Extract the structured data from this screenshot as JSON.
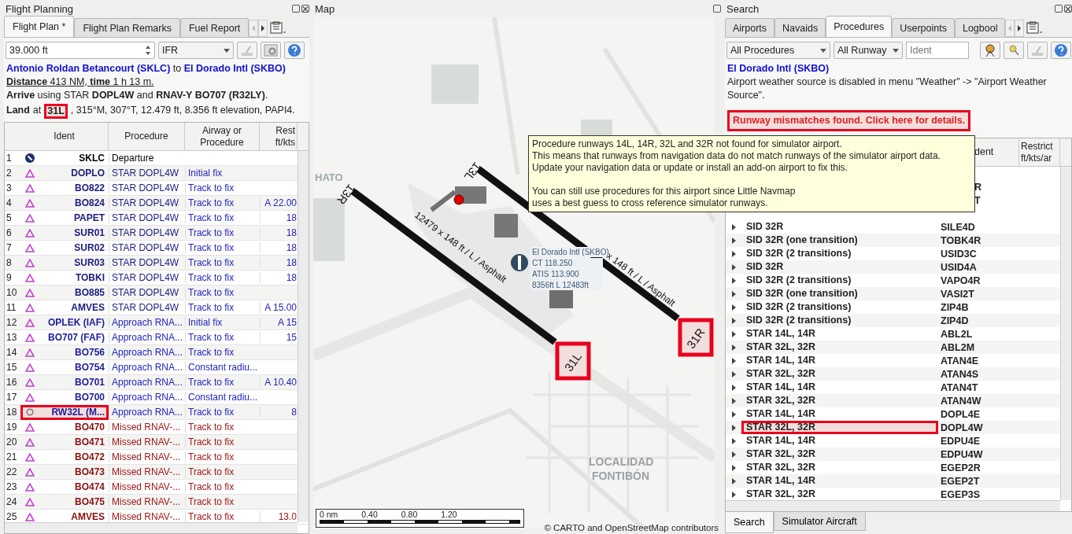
{
  "flight_planning": {
    "title": "Flight Planning",
    "tabs": [
      {
        "label": "Flight Plan *",
        "selected": true
      },
      {
        "label": "Flight Plan Remarks",
        "selected": false
      },
      {
        "label": "Fuel Report",
        "selected": false
      }
    ],
    "altitude": "39.000 ft",
    "flight_rules": "IFR",
    "route": {
      "from": "Antonio Roldan Betancourt (SKLC)",
      "joiner": "to",
      "to": "El Dorado Intl (SKBO)"
    },
    "distance": "**Distance** 413 NM, **time** 1 h 13 m.",
    "arrive": "**Arrive** using STAR **DOPL4W** and **RNAV-Y BO707 (R32LY)**.",
    "land": {
      "label": "Land",
      "prefix": "at",
      "runway": "31L",
      "runway_highlighted": true,
      "rest": ", 315°M, 307°T, 12.479 ft, 8.356 ft elevation, PAPI4."
    },
    "table": {
      "columns": [
        "Ident",
        "Procedure",
        "Airway or Procedure",
        "Rest ft/kts"
      ],
      "rows": [
        {
          "n": "1",
          "kind": "departure",
          "ident": "SKLC",
          "procedure": "Departure",
          "highlighted": false
        },
        {
          "n": "2",
          "kind": "star",
          "ident": "DOPLO",
          "procedure": "STAR DOPL4W",
          "leg": "Initial fix",
          "highlighted": false
        },
        {
          "n": "3",
          "kind": "star",
          "ident": "BO822",
          "procedure": "STAR DOPL4W",
          "leg": "Track to fix",
          "highlighted": false
        },
        {
          "n": "4",
          "kind": "star",
          "ident": "BO824",
          "procedure": "STAR DOPL4W",
          "leg": "Track to fix",
          "restriction": "A 22.00",
          "highlighted": false
        },
        {
          "n": "5",
          "kind": "star",
          "ident": "PAPET",
          "procedure": "STAR DOPL4W",
          "leg": "Track to fix",
          "restriction": "18",
          "highlighted": false
        },
        {
          "n": "6",
          "kind": "star",
          "ident": "SUR01",
          "procedure": "STAR DOPL4W",
          "leg": "Track to fix",
          "restriction": "18",
          "highlighted": false
        },
        {
          "n": "7",
          "kind": "star",
          "ident": "SUR02",
          "procedure": "STAR DOPL4W",
          "leg": "Track to fix",
          "restriction": "18",
          "highlighted": false
        },
        {
          "n": "8",
          "kind": "star",
          "ident": "SUR03",
          "procedure": "STAR DOPL4W",
          "leg": "Track to fix",
          "restriction": "18",
          "highlighted": false
        },
        {
          "n": "9",
          "kind": "star",
          "ident": "TOBKI",
          "procedure": "STAR DOPL4W",
          "leg": "Track to fix",
          "restriction": "18",
          "highlighted": false
        },
        {
          "n": "10",
          "kind": "star",
          "ident": "BO885",
          "procedure": "STAR DOPL4W",
          "leg": "Track to fix",
          "highlighted": false
        },
        {
          "n": "11",
          "kind": "star",
          "ident": "AMVES",
          "procedure": "STAR DOPL4W",
          "leg": "Track to fix",
          "restriction": "A 15.00",
          "highlighted": false
        },
        {
          "n": "12",
          "kind": "approach",
          "ident": "OPLEK (IAF)",
          "procedure": "Approach RNA...",
          "leg": "Initial fix",
          "restriction": "A 15",
          "highlighted": false
        },
        {
          "n": "13",
          "kind": "approach",
          "ident": "BO707 (FAF)",
          "procedure": "Approach RNA...",
          "leg": "Track to fix",
          "restriction": "15",
          "highlighted": false
        },
        {
          "n": "14",
          "kind": "approach",
          "ident": "BO756",
          "procedure": "Approach RNA...",
          "leg": "Track to fix",
          "highlighted": false
        },
        {
          "n": "15",
          "kind": "approach",
          "ident": "BO754",
          "procedure": "Approach RNA...",
          "leg": "Constant radiu...",
          "highlighted": false
        },
        {
          "n": "16",
          "kind": "approach",
          "ident": "BO701",
          "procedure": "Approach RNA...",
          "leg": "Track to fix",
          "restriction": "A 10.40",
          "highlighted": false
        },
        {
          "n": "17",
          "kind": "approach",
          "ident": "BO700",
          "procedure": "Approach RNA...",
          "leg": "Constant radiu...",
          "highlighted": false
        },
        {
          "n": "18",
          "kind": "runway",
          "ident": "RW32L (M...",
          "procedure": "Approach RNA...",
          "leg": "Track to fix",
          "restriction": "8",
          "highlighted": true
        },
        {
          "n": "19",
          "kind": "missed",
          "ident": "BO470",
          "procedure": "Missed RNAV-...",
          "leg": "Track to fix",
          "highlighted": false
        },
        {
          "n": "20",
          "kind": "missed",
          "ident": "BO471",
          "procedure": "Missed RNAV-...",
          "leg": "Track to fix",
          "highlighted": false
        },
        {
          "n": "21",
          "kind": "missed",
          "ident": "BO472",
          "procedure": "Missed RNAV-...",
          "leg": "Track to fix",
          "highlighted": false
        },
        {
          "n": "22",
          "kind": "missed",
          "ident": "BO473",
          "procedure": "Missed RNAV-...",
          "leg": "Track to fix",
          "highlighted": false
        },
        {
          "n": "23",
          "kind": "missed",
          "ident": "BO474",
          "procedure": "Missed RNAV-...",
          "leg": "Track to fix",
          "highlighted": false
        },
        {
          "n": "24",
          "kind": "missed",
          "ident": "BO475",
          "procedure": "Missed RNAV-...",
          "leg": "Track to fix",
          "highlighted": false
        },
        {
          "n": "25",
          "kind": "missed",
          "ident": "AMVES",
          "procedure": "Missed RNAV-...",
          "leg": "Track to fix",
          "restriction": "13.0",
          "highlighted": false
        }
      ]
    }
  },
  "map": {
    "title": "Map",
    "place_labels": [
      "HATO",
      "LOCALIDAD",
      "FONTIBÓN"
    ],
    "runways": [
      {
        "end_a": "13R",
        "end_b": "31L",
        "label": "12479 x 148 ft / L / Asphalt",
        "end_b_highlighted": true
      },
      {
        "end_a": "13L",
        "end_b": "31R",
        "label": "x 148 ft / L / Asphalt",
        "end_b_highlighted": true
      }
    ],
    "airport_label": [
      "El Dorado Intl (SKBO)",
      "CT 118.250",
      "ATIS 113.900",
      "8356ft L 12483ft"
    ],
    "scale": [
      "0 nm",
      "0.40",
      "0.80",
      "1.20"
    ],
    "attribution": "© CARTO and OpenStreetMap contributors"
  },
  "tooltip": {
    "paragraphs": [
      [
        "Procedure runways 14L, 14R, 32L and 32R not found for simulator airport.",
        "This means that runways from navigation data do not match runways of the simulator airport data.",
        "Update your navigation data or update or install an add-on airport to fix this."
      ],
      [
        "You can still use procedures for this airport since Little Navmap",
        "uses a best guess to cross reference simulator runways."
      ]
    ]
  },
  "search": {
    "title": "Search",
    "tabs": [
      {
        "label": "Airports",
        "selected": false
      },
      {
        "label": "Navaids",
        "selected": false
      },
      {
        "label": "Procedures",
        "selected": true
      },
      {
        "label": "Userpoints",
        "selected": false
      },
      {
        "label": "Logbool",
        "selected": false
      }
    ],
    "filter_type": "All Procedures",
    "filter_runway": "All Runway",
    "ident_placeholder": "Ident",
    "airport": "El Dorado Intl (SKBO)",
    "weather_note": "Airport weather source is disabled in menu \"Weather\" -> \"Airport Weather Source\".",
    "mismatch_link": "Runway mismatches found. Click here for details.",
    "mismatch_highlighted": true,
    "columns": [
      "dent",
      "Restrict ft/kts/ar"
    ],
    "partial_rows": [
      "R",
      "T"
    ],
    "rows": [
      {
        "description": "SID 32R",
        "ident": "SILE4D",
        "highlighted": false
      },
      {
        "description": "SID 32R (one transition)",
        "ident": "TOBK4R",
        "highlighted": false
      },
      {
        "description": "SID 32R (2 transitions)",
        "ident": "USID3C",
        "highlighted": false
      },
      {
        "description": "SID 32R",
        "ident": "USID4A",
        "highlighted": false
      },
      {
        "description": "SID 32R (2 transitions)",
        "ident": "VAPO4R",
        "highlighted": false
      },
      {
        "description": "SID 32R (one transition)",
        "ident": "VASI2T",
        "highlighted": false
      },
      {
        "description": "SID 32R (2 transitions)",
        "ident": "ZIP4B",
        "highlighted": false
      },
      {
        "description": "SID 32R (2 transitions)",
        "ident": "ZIP4D",
        "highlighted": false
      },
      {
        "description": "STAR 14L, 14R",
        "ident": "ABL2L",
        "highlighted": false
      },
      {
        "description": "STAR 32L, 32R",
        "ident": "ABL2M",
        "highlighted": false
      },
      {
        "description": "STAR 14L, 14R",
        "ident": "ATAN4E",
        "highlighted": false
      },
      {
        "description": "STAR 32L, 32R",
        "ident": "ATAN4S",
        "highlighted": false
      },
      {
        "description": "STAR 14L, 14R",
        "ident": "ATAN4T",
        "highlighted": false
      },
      {
        "description": "STAR 32L, 32R",
        "ident": "ATAN4W",
        "highlighted": false
      },
      {
        "description": "STAR 14L, 14R",
        "ident": "DOPL4E",
        "highlighted": false
      },
      {
        "description": "STAR 32L, 32R",
        "ident": "DOPL4W",
        "highlighted": true
      },
      {
        "description": "STAR 14L, 14R",
        "ident": "EDPU4E",
        "highlighted": false
      },
      {
        "description": "STAR 32L, 32R",
        "ident": "EDPU4W",
        "highlighted": false
      },
      {
        "description": "STAR 32L, 32R",
        "ident": "EGEP2R",
        "highlighted": false
      },
      {
        "description": "STAR 14L, 14R",
        "ident": "EGEP2T",
        "highlighted": false
      },
      {
        "description": "STAR 32L, 32R",
        "ident": "EGEP3S",
        "highlighted": false
      }
    ],
    "bottom_tabs": [
      {
        "label": "Search",
        "selected": true
      },
      {
        "label": "Simulator Aircraft",
        "selected": false
      }
    ]
  }
}
